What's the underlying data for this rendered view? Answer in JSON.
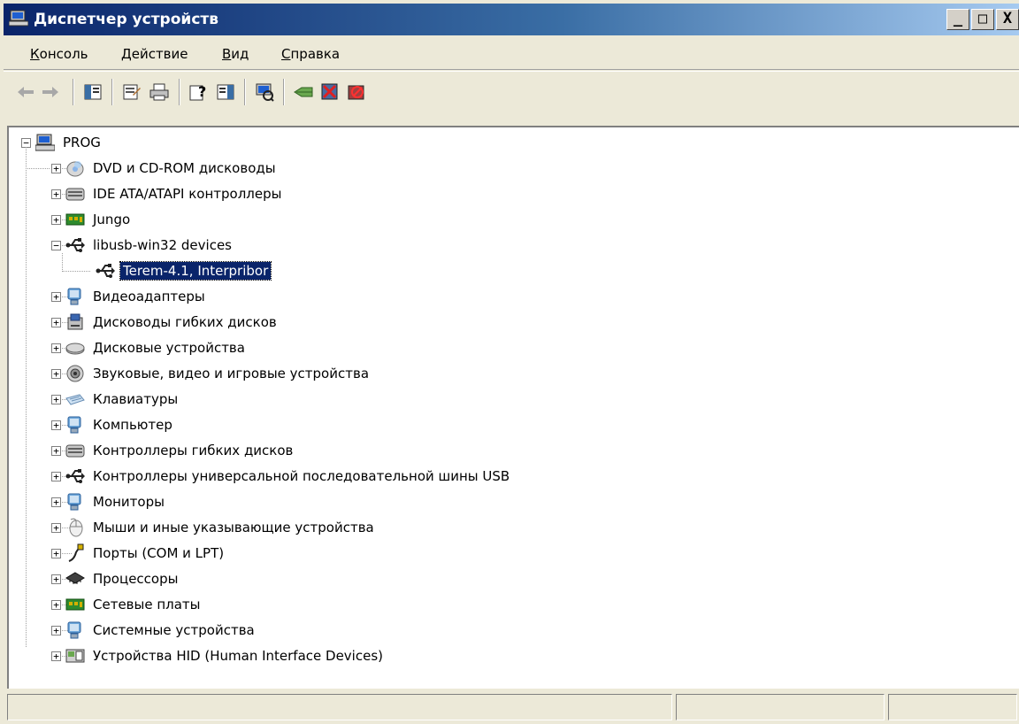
{
  "window": {
    "title": "Диспетчер устройств"
  },
  "window_buttons": {
    "minimize": "_",
    "maximize": "□",
    "close": "X"
  },
  "menu": [
    {
      "label_ul": "К",
      "label_rest": "онсоль"
    },
    {
      "label_ul": "Д",
      "label_rest": "ействие"
    },
    {
      "label_ul": "В",
      "label_rest": "ид"
    },
    {
      "label_ul": "С",
      "label_rest": "правка"
    }
  ],
  "toolbar": [
    "back-icon",
    "forward-icon",
    "show-hide-tree-icon",
    "properties-icon",
    "print-icon",
    "help-icon",
    "console-tree-icon",
    "scan-hardware-icon",
    "update-driver-icon",
    "uninstall-icon",
    "disable-icon"
  ],
  "tree": {
    "root": {
      "label": "PROG",
      "icon": "computer-icon"
    },
    "items": [
      {
        "label": "DVD и CD-ROM дисководы",
        "icon": "cdrom-icon",
        "expanded": false
      },
      {
        "label": "IDE ATA/ATAPI контроллеры",
        "icon": "ide-controller-icon",
        "expanded": false
      },
      {
        "label": "Jungo",
        "icon": "board-icon",
        "expanded": false
      },
      {
        "label": "libusb-win32 devices",
        "icon": "usb-icon",
        "expanded": true,
        "children": [
          {
            "label": "Terem-4.1, Interpribor",
            "icon": "usb-icon",
            "selected": true
          }
        ]
      },
      {
        "label": "Видеоадаптеры",
        "icon": "monitor-icon",
        "expanded": false
      },
      {
        "label": "Дисководы гибких дисков",
        "icon": "floppy-drive-icon",
        "expanded": false
      },
      {
        "label": "Дисковые устройства",
        "icon": "disk-icon",
        "expanded": false
      },
      {
        "label": "Звуковые, видео и игровые устройства",
        "icon": "speaker-icon",
        "expanded": false
      },
      {
        "label": "Клавиатуры",
        "icon": "keyboard-icon",
        "expanded": false
      },
      {
        "label": "Компьютер",
        "icon": "monitor-icon",
        "expanded": false
      },
      {
        "label": "Контроллеры гибких дисков",
        "icon": "ide-controller-icon",
        "expanded": false
      },
      {
        "label": "Контроллеры универсальной последовательной шины USB",
        "icon": "usb-icon",
        "expanded": false
      },
      {
        "label": "Мониторы",
        "icon": "monitor-icon",
        "expanded": false
      },
      {
        "label": "Мыши и иные указывающие устройства",
        "icon": "mouse-icon",
        "expanded": false
      },
      {
        "label": "Порты (COM и LPT)",
        "icon": "port-icon",
        "expanded": false
      },
      {
        "label": "Процессоры",
        "icon": "cpu-icon",
        "expanded": false
      },
      {
        "label": "Сетевые платы",
        "icon": "board-icon",
        "expanded": false
      },
      {
        "label": "Системные устройства",
        "icon": "monitor-icon",
        "expanded": false
      },
      {
        "label": "Устройства HID (Human Interface Devices)",
        "icon": "hid-icon",
        "expanded": false
      }
    ]
  },
  "colors": {
    "titlebar_start": "#0a246a",
    "titlebar_end": "#a6caf0",
    "selection": "#0a246a",
    "face": "#ece9d8"
  }
}
